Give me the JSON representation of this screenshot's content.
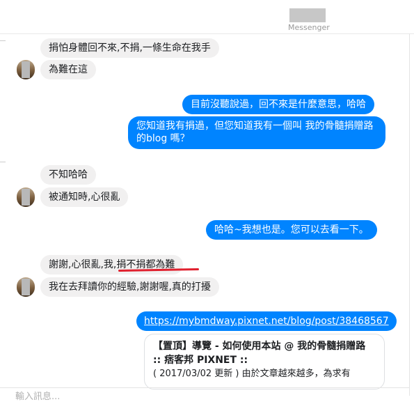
{
  "header": {
    "app_label": "Messenger"
  },
  "messages": [
    {
      "id": "m1",
      "direction": "incoming",
      "text": "捐怕身體回不來,不捐,一條生命在我手"
    },
    {
      "id": "m2",
      "direction": "incoming",
      "text": "為難在這"
    },
    {
      "id": "m3",
      "direction": "outgoing",
      "text": "目前沒聽說過，回不來是什麼意思，哈哈"
    },
    {
      "id": "m4",
      "direction": "outgoing",
      "text": "您知道我有捐過，但您知道我有一個叫 我的骨髓捐贈路 的blog 嗎？"
    },
    {
      "id": "m5",
      "direction": "incoming",
      "text": "不知哈哈"
    },
    {
      "id": "m6",
      "direction": "incoming",
      "text": "被通知時,心很亂"
    },
    {
      "id": "m7",
      "direction": "outgoing",
      "text": "哈哈~我想也是。您可以去看一下。"
    },
    {
      "id": "m8",
      "direction": "incoming",
      "text": "謝謝,心很亂,我,捐不捐都為難"
    },
    {
      "id": "m9",
      "direction": "incoming",
      "text": "我在去拜讀你的經驗,謝謝喔,真的打擾"
    },
    {
      "id": "m10",
      "direction": "outgoing",
      "text": "https://mybmdway.pixnet.net/blog/post/38468567"
    }
  ],
  "link_preview": {
    "title": "【置頂】導覽 - 如何使用本站 @ 我的骨髓捐贈路 :: 痞客邦 PIXNET ::",
    "description": "( 2017/03/02 更新 ) 由於文章越來越多，為求有"
  },
  "composer": {
    "placeholder": "輸入訊息..."
  },
  "colors": {
    "outgoing_bubble": "#0084ff",
    "incoming_bubble": "#f1f0f0",
    "highlight_underline": "#e0202e"
  }
}
